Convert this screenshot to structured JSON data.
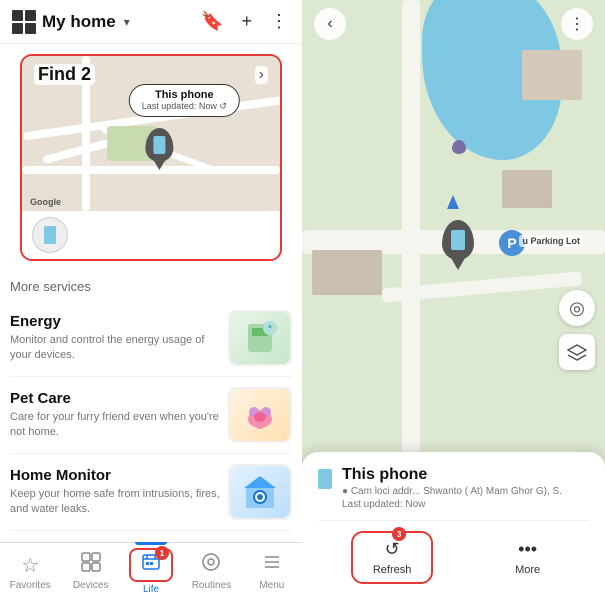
{
  "app": {
    "title": "My home",
    "dropdown_arrow": "▾"
  },
  "top_bar": {
    "title": "My home",
    "icons": {
      "home": "⊞",
      "bookmark": "🔖",
      "add": "+",
      "more": "⋮"
    }
  },
  "find_section": {
    "label": "Find",
    "number_badge": "2",
    "arrow": "›",
    "phone_tooltip": {
      "title": "This phone",
      "subtitle": "Last updated: Now ↺"
    },
    "google_label": "Google"
  },
  "device_list": [
    {
      "name": "This phone",
      "icon": "phone"
    }
  ],
  "more_services": {
    "label": "More services",
    "items": [
      {
        "title": "Energy",
        "description": "Monitor and control the energy usage of your devices.",
        "icon": "⚡"
      },
      {
        "title": "Pet Care",
        "description": "Care for your furry friend even when you're not home.",
        "icon": "🐾"
      },
      {
        "title": "Home Monitor",
        "description": "Keep your home safe from intrusions, fires, and water leaks.",
        "icon": "👁"
      }
    ]
  },
  "bottom_nav": {
    "items": [
      {
        "label": "Favorites",
        "icon": "☆",
        "active": false
      },
      {
        "label": "Devices",
        "icon": "⊞",
        "active": false
      },
      {
        "label": "Life",
        "icon": "≡",
        "active": true,
        "badge": "1"
      },
      {
        "label": "Routines",
        "icon": "⊙",
        "active": false
      },
      {
        "label": "Menu",
        "icon": "≡",
        "active": false
      }
    ]
  },
  "right_panel": {
    "back_icon": "‹",
    "more_icon": "⋮",
    "parking_label": "u Parking Lot",
    "bottom_card": {
      "title": "This phone",
      "location": "● Cam loci addr... Shwanto ( At) Mam Ghor G), S.",
      "updated": "Last updated: Now",
      "actions": [
        {
          "label": "Refresh",
          "icon": "↺",
          "badge": "3",
          "highlighted": true
        },
        {
          "label": "More",
          "icon": "…",
          "highlighted": false
        }
      ]
    }
  }
}
